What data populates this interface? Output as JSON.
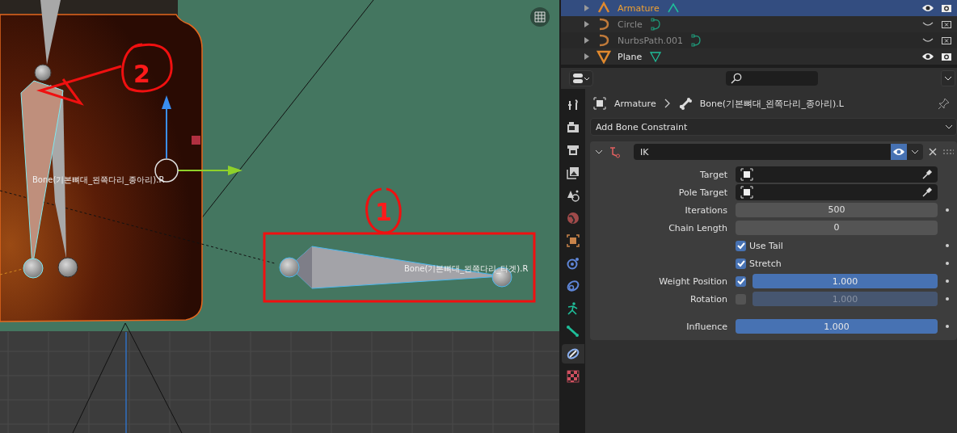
{
  "viewport": {
    "bone_labels": [
      {
        "text": "Bone(기본뼈대_왼쪽다리_종아리).R"
      },
      {
        "text": "Bone(기본뼈대_왼쪽다리_타겟).R"
      }
    ],
    "annotations": [
      {
        "text": "2"
      },
      {
        "text": "1"
      }
    ]
  },
  "outliner": {
    "rows": [
      {
        "name": "Armature",
        "kind": "armature",
        "selected": true,
        "visible": true
      },
      {
        "name": "Circle",
        "kind": "curve",
        "selected": false,
        "visible": false
      },
      {
        "name": "NurbsPath.001",
        "kind": "curve",
        "selected": false,
        "visible": false
      },
      {
        "name": "Plane",
        "kind": "mesh",
        "selected": false,
        "visible": true
      }
    ]
  },
  "properties": {
    "tabs": [
      {
        "kind": "tool",
        "selected": false
      },
      {
        "kind": "render",
        "selected": false
      },
      {
        "kind": "output",
        "selected": false
      },
      {
        "kind": "view_layer",
        "selected": false
      },
      {
        "kind": "scene",
        "selected": false
      },
      {
        "kind": "world",
        "selected": false
      },
      {
        "kind": "object",
        "selected": false
      },
      {
        "kind": "physics",
        "selected": false
      },
      {
        "kind": "object_constraint",
        "selected": false
      },
      {
        "kind": "armature_data",
        "selected": false
      },
      {
        "kind": "bone",
        "selected": false
      },
      {
        "kind": "bone_constraint",
        "selected": true
      },
      {
        "kind": "texture",
        "selected": false
      }
    ],
    "breadcrumb": [
      "Armature",
      "Bone(기본뼈대_왼쪽다리_종아리).L"
    ],
    "add_menu": "Add Bone Constraint",
    "constraint": {
      "name": "IK",
      "expanded": true,
      "enabled": true,
      "fields": [
        {
          "kind": "object",
          "label": "Target"
        },
        {
          "kind": "object",
          "label": "Pole Target"
        },
        {
          "kind": "number",
          "label": "Iterations",
          "value": "500"
        },
        {
          "kind": "number",
          "label": "Chain Length",
          "value": "0"
        },
        {
          "kind": "checkbox",
          "label": "Use Tail",
          "checked": true
        },
        {
          "kind": "checkbox",
          "label": "Stretch",
          "checked": true
        },
        {
          "kind": "weight",
          "label": "Weight Position",
          "checked": true,
          "value": "1.000",
          "level": 1
        },
        {
          "kind": "weight",
          "label": "Rotation",
          "checked": false,
          "value": "1.000",
          "level": 1
        },
        {
          "kind": "slider",
          "label": "Influence",
          "value": "1.000",
          "level": 1
        }
      ]
    }
  }
}
